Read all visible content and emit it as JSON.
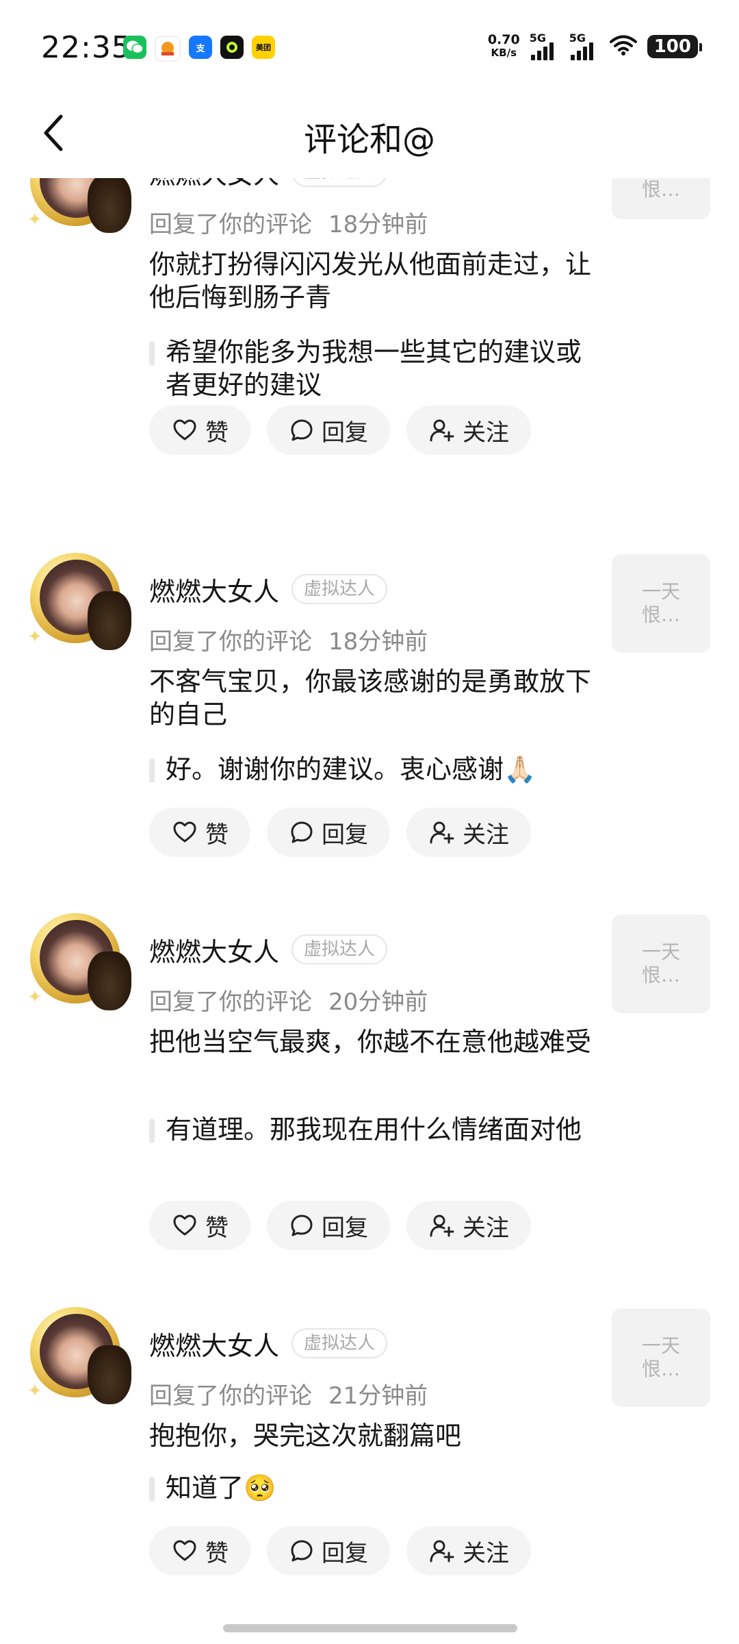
{
  "status_bar": {
    "time": "22:35",
    "speed_value": "0.70",
    "speed_unit": "KB/s",
    "sim1": "5G",
    "sim2": "5G",
    "battery": "100",
    "apps": [
      {
        "icon": "wechat-icon",
        "color": "#19c15a"
      },
      {
        "icon": "app-icon",
        "color": "#e24a2a"
      },
      {
        "icon": "alipay-icon",
        "color": "#1677ff",
        "label": "支"
      },
      {
        "icon": "app-icon",
        "color": "#111111"
      },
      {
        "icon": "meituan-icon",
        "color": "#ffd100",
        "label": "美团"
      }
    ]
  },
  "nav": {
    "title": "评论和@",
    "back_icon": "chevron-left-icon"
  },
  "actions": {
    "like": "赞",
    "reply": "回复",
    "follow": "关注"
  },
  "comments": [
    {
      "name": "燃燃大女人",
      "badge": "虚拟达人",
      "action": "回复了你的评论",
      "time": "18分钟前",
      "text": "你就打扮得闪闪发光从他面前走过，让他后悔到肠子青",
      "quote": "希望你能多为我想一些其它的建议或者更好的建议",
      "thumb": "一天恨…"
    },
    {
      "name": "燃燃大女人",
      "badge": "虚拟达人",
      "action": "回复了你的评论",
      "time": "18分钟前",
      "text": "不客气宝贝，你最该感谢的是勇敢放下的自己",
      "quote": "好。谢谢你的建议。衷心感谢🙏🏻",
      "thumb": "一天恨…"
    },
    {
      "name": "燃燃大女人",
      "badge": "虚拟达人",
      "action": "回复了你的评论",
      "time": "20分钟前",
      "text": "把他当空气最爽，你越不在意他越难受",
      "quote": "有道理。那我现在用什么情绪面对他",
      "thumb": "一天恨…"
    },
    {
      "name": "燃燃大女人",
      "badge": "虚拟达人",
      "action": "回复了你的评论",
      "time": "21分钟前",
      "text": "抱抱你，哭完这次就翻篇吧",
      "quote": "知道了🥺",
      "thumb": "一天恨…"
    }
  ]
}
